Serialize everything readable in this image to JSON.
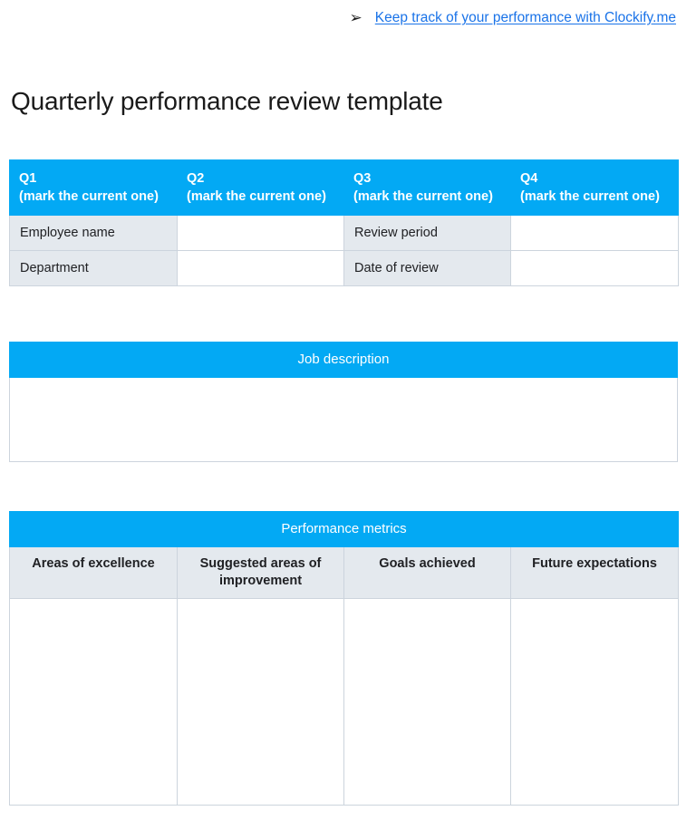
{
  "promo": {
    "arrow_icon": "arrow-right-icon",
    "link_text": "Keep track of your performance with Clockify.me",
    "link_color": "#1a73e8"
  },
  "page": {
    "title": "Quarterly performance review template",
    "accent_color": "#03a9f4",
    "label_fill_color": "#e4e9ee",
    "border_color": "#ccd4dd"
  },
  "quarters_table": {
    "headers": [
      "Q1\n(mark the current one)",
      "Q2\n(mark the current one)",
      "Q3\n(mark the current one)",
      "Q4\n(mark the current one)"
    ],
    "rows": [
      {
        "label_left": "Employee name",
        "value_left": "",
        "label_right": "Review period",
        "value_right": ""
      },
      {
        "label_left": "Department",
        "value_left": "",
        "label_right": "Date of review",
        "value_right": ""
      }
    ]
  },
  "job_table": {
    "header": "Job description",
    "body_value": ""
  },
  "metrics_table": {
    "header": "Performance metrics",
    "columns": [
      "Areas of excellence",
      "Suggested areas of improvement",
      "Goals achieved",
      "Future expectations"
    ],
    "values": [
      "",
      "",
      "",
      ""
    ]
  }
}
